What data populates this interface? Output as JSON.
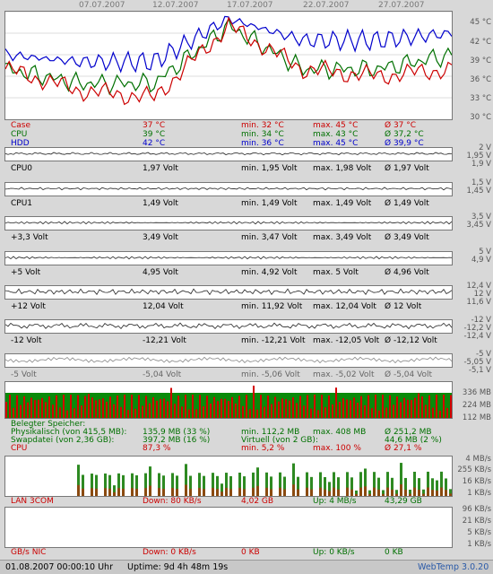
{
  "dates": [
    "07.07.2007",
    "12.07.2007",
    "17.07.2007",
    "22.07.2007",
    "27.07.2007"
  ],
  "temp": {
    "y_labels": [
      "45 °C",
      "42 °C",
      "39 °C",
      "36 °C",
      "33 °C",
      "30 °C"
    ],
    "rows": [
      {
        "name": "Case",
        "cur": "37 °C",
        "min": "min. 32 °C",
        "max": "max. 45 °C",
        "avg": "Ø 37 °C",
        "color": "#cc0000"
      },
      {
        "name": "CPU",
        "cur": "39 °C",
        "min": "min. 34 °C",
        "max": "max. 43 °C",
        "avg": "Ø 37,2 °C",
        "color": "#007000"
      },
      {
        "name": "HDD",
        "cur": "42 °C",
        "min": "min. 36 °C",
        "max": "max. 45 °C",
        "avg": "Ø 39,9 °C",
        "color": "#0000cc"
      }
    ]
  },
  "voltages": [
    {
      "name": "CPU0",
      "cur": "1,97 Volt",
      "min": "min. 1,95 Volt",
      "max": "max. 1,98 Volt",
      "avg": "Ø 1,97 Volt",
      "y_labels": [
        "2 V",
        "1,95 V",
        "1,9 V"
      ]
    },
    {
      "name": "CPU1",
      "cur": "1,49 Volt",
      "min": "min. 1,49 Volt",
      "max": "max. 1,49 Volt",
      "avg": "Ø 1,49 Volt",
      "y_labels": [
        "1,5 V",
        "1,45 V"
      ]
    },
    {
      "name": "+3,3 Volt",
      "cur": "3,49 Volt",
      "min": "min. 3,47 Volt",
      "max": "max. 3,49 Volt",
      "avg": "Ø 3,49 Volt",
      "y_labels": [
        "3,5 V",
        "3,45 V"
      ]
    },
    {
      "name": "+5 Volt",
      "cur": "4,95 Volt",
      "min": "min. 4,92 Volt",
      "max": "max. 5 Volt",
      "avg": "Ø 4,96 Volt",
      "y_labels": [
        "5 V",
        "4,9 V"
      ]
    },
    {
      "name": "+12 Volt",
      "cur": "12,04 Volt",
      "min": "min. 11,92 Volt",
      "max": "max. 12,04 Volt",
      "avg": "Ø 12 Volt",
      "y_labels": [
        "12,4 V",
        "12 V",
        "11,6 V"
      ]
    },
    {
      "name": "-12 Volt",
      "cur": "-12,21 Volt",
      "min": "min. -12,21 Volt",
      "max": "max. -12,05 Volt",
      "avg": "Ø -12,12 Volt",
      "y_labels": [
        "-12 V",
        "-12,2 V",
        "-12,4 V"
      ]
    },
    {
      "name": "-5 Volt",
      "cur": "-5,04 Volt",
      "min": "min. -5,06 Volt",
      "max": "max. -5,02 Volt",
      "avg": "Ø -5,04 Volt",
      "y_labels": [
        "-5 V",
        "-5,05 V",
        "-5,1 V"
      ]
    }
  ],
  "memory": {
    "y_labels": [
      "336 MB",
      "224 MB",
      "112 MB"
    ],
    "header": "Belegter Speicher:",
    "phys_label": "Physikalisch (von 415,5 MB):",
    "phys_cur": "135,9 MB (33 %)",
    "phys_min": "min. 112,2 MB",
    "phys_max": "max. 408 MB",
    "phys_avg": "Ø 251,2 MB",
    "swap_label": "Swapdatei (von 2,36 GB):",
    "swap_cur": "397,2 MB (16 %)",
    "swap_min": "Virtuell (von 2 GB):",
    "swap_avg": "44,6 MB (2 %)",
    "cpu_label": "CPU",
    "cpu_cur": "87,3 %",
    "cpu_min": "min. 5,2 %",
    "cpu_max": "max. 100 %",
    "cpu_avg": "Ø 27,1 %"
  },
  "lan": {
    "y_labels": [
      "4 MB/s",
      "255 KB/s",
      "16 KB/s",
      "1 KB/s"
    ],
    "name": "LAN 3COM",
    "down": "Down: 80 KB/s",
    "down_total": "4,02 GB",
    "up": "Up: 4 MB/s",
    "up_total": "43,29 GB"
  },
  "nic": {
    "y_labels": [
      "96 KB/s",
      "21 KB/s",
      "5 KB/s",
      "1 KB/s"
    ],
    "name": "GB/s NIC",
    "down": "Down: 0 KB/s",
    "down_total": "0 KB",
    "up": "Up: 0 KB/s",
    "up_total": "0 KB"
  },
  "status": {
    "datetime": "01.08.2007 00:00:10 Uhr",
    "uptime": "Uptime: 9d 4h 48m 19s",
    "app": "WebTemp 3.0.20"
  },
  "chart_data": {
    "type": "line",
    "title": "",
    "x": [
      "07.07.2007",
      "12.07.2007",
      "17.07.2007",
      "22.07.2007",
      "27.07.2007"
    ],
    "ylim": [
      30,
      45
    ],
    "series": [
      {
        "name": "Case",
        "values": [
          37,
          34,
          33,
          43,
          37,
          36,
          37
        ]
      },
      {
        "name": "CPU",
        "values": [
          37,
          35,
          35,
          43,
          37,
          37,
          39
        ]
      },
      {
        "name": "HDD",
        "values": [
          39,
          38,
          38,
          44,
          41,
          41,
          42
        ]
      }
    ]
  }
}
